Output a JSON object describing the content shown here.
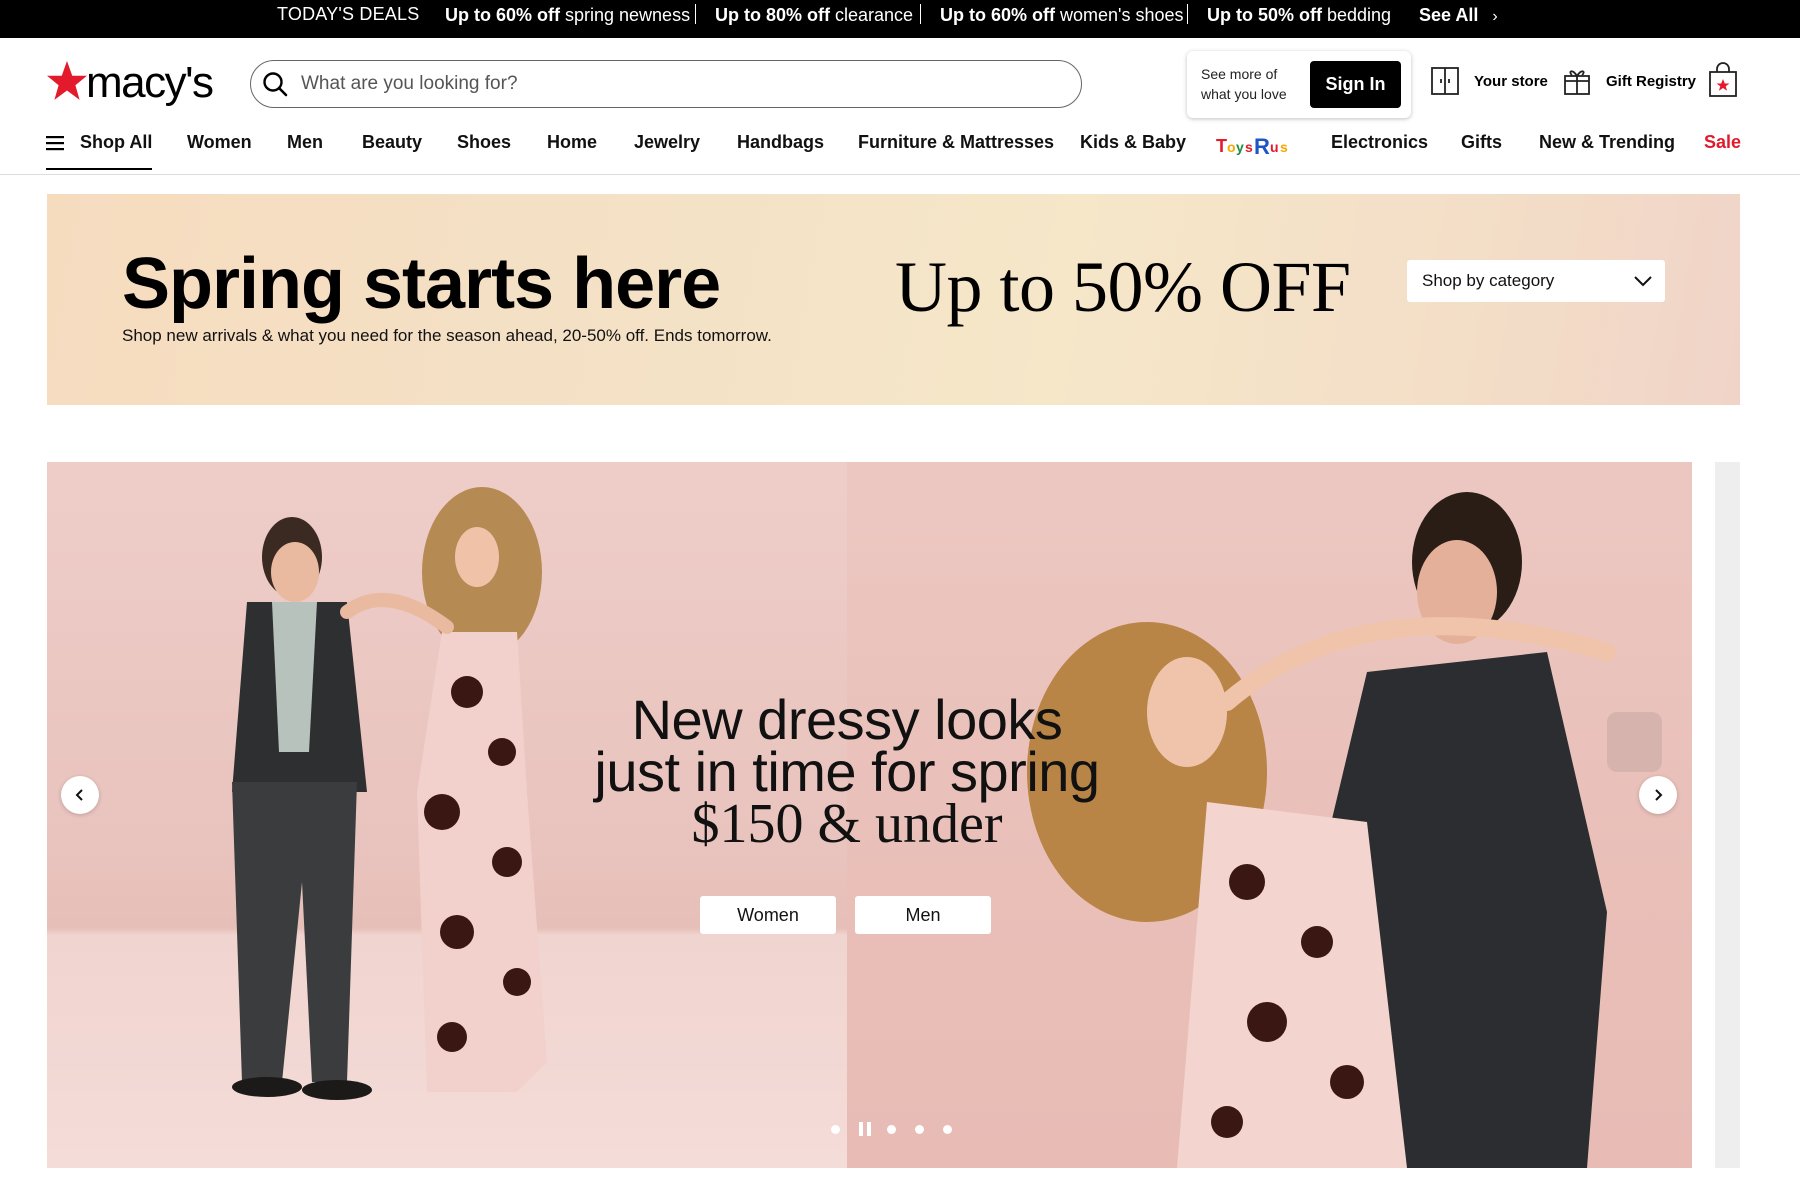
{
  "deals_bar": {
    "title": "TODAY'S DEALS",
    "deals": [
      {
        "bold": "Up to 60% off",
        "rest": " spring newness"
      },
      {
        "bold": "Up to 80% off",
        "rest": " clearance"
      },
      {
        "bold": "Up to 60% off",
        "rest": " women's shoes"
      },
      {
        "bold": "Up to 50% off",
        "rest": " bedding"
      }
    ],
    "see_all": "See All"
  },
  "header": {
    "logo_text": "macy's",
    "search": {
      "placeholder": "What are you looking for?",
      "value": ""
    },
    "signin_prompt": [
      "See more of",
      "what you love"
    ],
    "signin_label": "Sign In",
    "store_label": "Your store",
    "registry_label": "Gift Registry"
  },
  "nav": {
    "shop_all": "Shop All",
    "items": [
      "Women",
      "Men",
      "Beauty",
      "Shoes",
      "Home",
      "Jewelry",
      "Handbags",
      "Furniture & Mattresses",
      "Kids & Baby",
      "Electronics",
      "Gifts",
      "New & Trending",
      "Sale"
    ],
    "toys_logo_text": "ToysRUs"
  },
  "promo": {
    "headline": "Spring starts here",
    "subtext": "Shop new arrivals & what you need for the season ahead, 20-50% off. Ends tomorrow.",
    "offer": "Up to 50% OFF",
    "select_label": "Shop by category"
  },
  "hero": {
    "line1": "New dressy looks",
    "line2": "just in time for spring",
    "line3": "$150 & under",
    "buttons": [
      "Women",
      "Men"
    ],
    "slide_count": 5,
    "current_slide": 2
  },
  "colors": {
    "brand_red": "#e21a2c",
    "black": "#000000",
    "promo_bg": "#f5e2c8",
    "hero_bg": "#ecc7c1"
  },
  "icons": [
    "search-icon",
    "store-icon",
    "gift-icon",
    "shopping-bag-icon",
    "hamburger-icon",
    "chevron-down-icon",
    "chevron-left-icon",
    "chevron-right-icon",
    "pause-icon"
  ]
}
